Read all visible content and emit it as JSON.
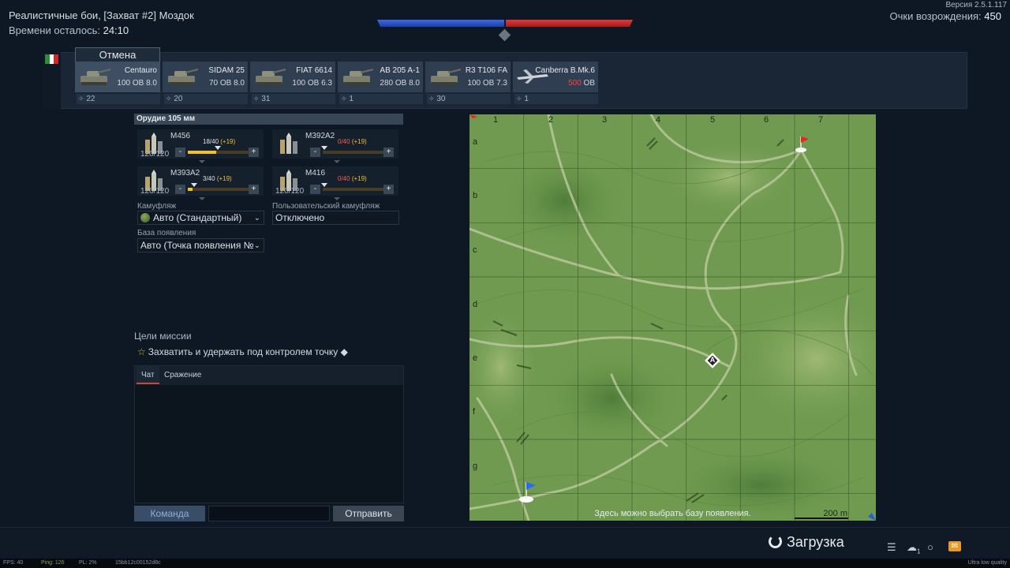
{
  "header": {
    "mode_title": "Реалистичные бои, [Захват #2] Моздок",
    "time_label": "Времени осталось:",
    "time_value": "24:10",
    "version": "Версия 2.5.1.117",
    "spawn_points_label": "Очки возрождения:",
    "spawn_points_value": "450"
  },
  "score": {
    "blue_fraction": 0.5,
    "red_fraction": 0.5,
    "colors": {
      "blue": "#2c56d0",
      "red": "#d02c2c"
    }
  },
  "vehicle_bar": {
    "cancel_label": "Отмена",
    "nation_flag_colors": [
      "#2e8b3a",
      "#ffffff",
      "#cf2a2a"
    ],
    "slots": [
      {
        "name": "Centauro",
        "cost": "100",
        "br": "8.0",
        "currency": "ОВ",
        "crew": "22",
        "active": true
      },
      {
        "name": "SIDAM 25",
        "cost": "70",
        "br": "8.0",
        "currency": "ОВ",
        "crew": "20",
        "active": false
      },
      {
        "name": "FIAT 6614",
        "cost": "100",
        "br": "6.3",
        "currency": "ОВ",
        "crew": "31",
        "active": false
      },
      {
        "name": "AB 205 A-1",
        "cost": "280",
        "br": "8.0",
        "currency": "ОВ",
        "crew": "1",
        "active": false
      },
      {
        "name": "R3 T106 FA",
        "cost": "100",
        "br": "7.3",
        "currency": "ОВ",
        "crew": "30",
        "active": false
      },
      {
        "name": "Canberra B.Mk.6",
        "cost": "500",
        "br": "",
        "currency": "ОВ",
        "crew": "1",
        "active": false,
        "cost_unavailable": true
      }
    ]
  },
  "loadout": {
    "weapon_header": "Орудие 105 мм",
    "ammo": [
      {
        "name": "M456",
        "count": "18/40",
        "bonus": "(+19)",
        "total": "120/120",
        "fill": 0.45,
        "zero": false
      },
      {
        "name": "M392A2",
        "count": "0/40",
        "bonus": "(+19)",
        "total": "",
        "fill": 0.0,
        "zero": true
      },
      {
        "name": "M393A2",
        "count": "3/40",
        "bonus": "(+19)",
        "total": "120/120",
        "fill": 0.075,
        "zero": false
      },
      {
        "name": "M416",
        "count": "0/40",
        "bonus": "(+19)",
        "total": "120/120",
        "fill": 0.0,
        "zero": true
      }
    ],
    "camo_label": "Камуфляж",
    "camo_value": "Авто (Стандартный)",
    "custom_camo_label": "Пользовательский камуфляж",
    "custom_camo_value": "Отключено",
    "spawn_base_label": "База появления",
    "spawn_base_value": "Авто (Точка появления №"
  },
  "mission": {
    "title": "Цели миссии",
    "objective": "Захватить и удержать под контролем точку"
  },
  "chat": {
    "tabs": [
      "Чат",
      "Сражение"
    ],
    "team_button": "Команда",
    "send_button": "Отправить"
  },
  "map": {
    "columns": [
      "1",
      "2",
      "3",
      "4",
      "5",
      "6",
      "7"
    ],
    "rows": [
      "a",
      "b",
      "c",
      "d",
      "e",
      "f",
      "g"
    ],
    "capture_point": "A",
    "hint": "Здесь можно выбрать базу появления.",
    "scale": "200 m"
  },
  "bottom": {
    "loading": "Загрузка",
    "icons": [
      "list-icon",
      "squad-icon",
      "chat-bubble-icon",
      "mail-icon"
    ],
    "squad_count": "1"
  },
  "status": {
    "fps": "FPS: 40",
    "ping": "Ping: 126",
    "pl": "PL: 2%",
    "session": "15bb12c00152d8c",
    "quality": "Ultra low quality"
  }
}
